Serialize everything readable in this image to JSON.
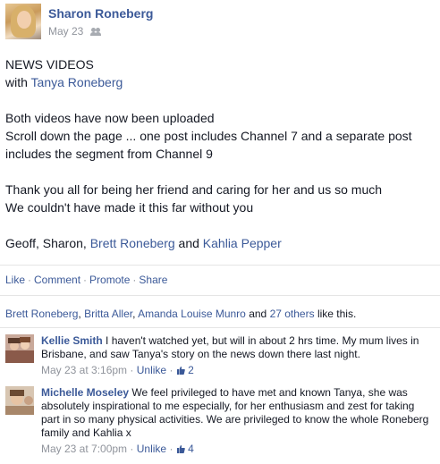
{
  "post": {
    "author": "Sharon Roneberg",
    "date": "May 23",
    "audience_icon": "friends-icon",
    "title_line": "NEWS VIDEOS",
    "with_prefix": "with ",
    "with_person": "Tanya Roneberg",
    "paragraph1_line1": "Both videos have now been uploaded",
    "paragraph1_line2": "Scroll down the page ... one post includes Channel 7 and a separate post",
    "paragraph1_line3": "includes the segment from Channel 9",
    "paragraph2_line1": "Thank you all for being her friend and caring for her and us so much",
    "paragraph2_line2": "We couldn't have made it this far without you",
    "signoff_prefix": "Geoff, Sharon, ",
    "signoff_person1": "Brett Roneberg",
    "signoff_and": " and ",
    "signoff_person2": "Kahlia Pepper"
  },
  "actions": {
    "like": "Like",
    "comment": "Comment",
    "promote": "Promote",
    "share": "Share",
    "separator": "·"
  },
  "likes": {
    "person1": "Brett Roneberg",
    "person2": "Britta Aller",
    "person3": "Amanda Louise Munro",
    "and_text": " and ",
    "others": "27 others",
    "suffix": " like this."
  },
  "comments": [
    {
      "name": "Kellie Smith",
      "text": "I haven't watched yet, but will in about 2 hrs time. My mum lives in Brisbane, and saw Tanya's story on the news down there last night.",
      "time": "May 23 at 3:16pm",
      "unlike": "Unlike",
      "like_count": "2"
    },
    {
      "name": "Michelle Moseley",
      "text": "We feel privileged to have met and known Tanya, she was absolutely inspirational to me especially, for her enthusiasm and zest for taking part in so many physical activities. We are privileged to know the whole Roneberg family and Kahlia x",
      "time": "May 23 at 7:00pm",
      "unlike": "Unlike",
      "like_count": "4"
    }
  ],
  "colors": {
    "link": "#3b5998",
    "meta": "#90949c",
    "text": "#141823"
  }
}
